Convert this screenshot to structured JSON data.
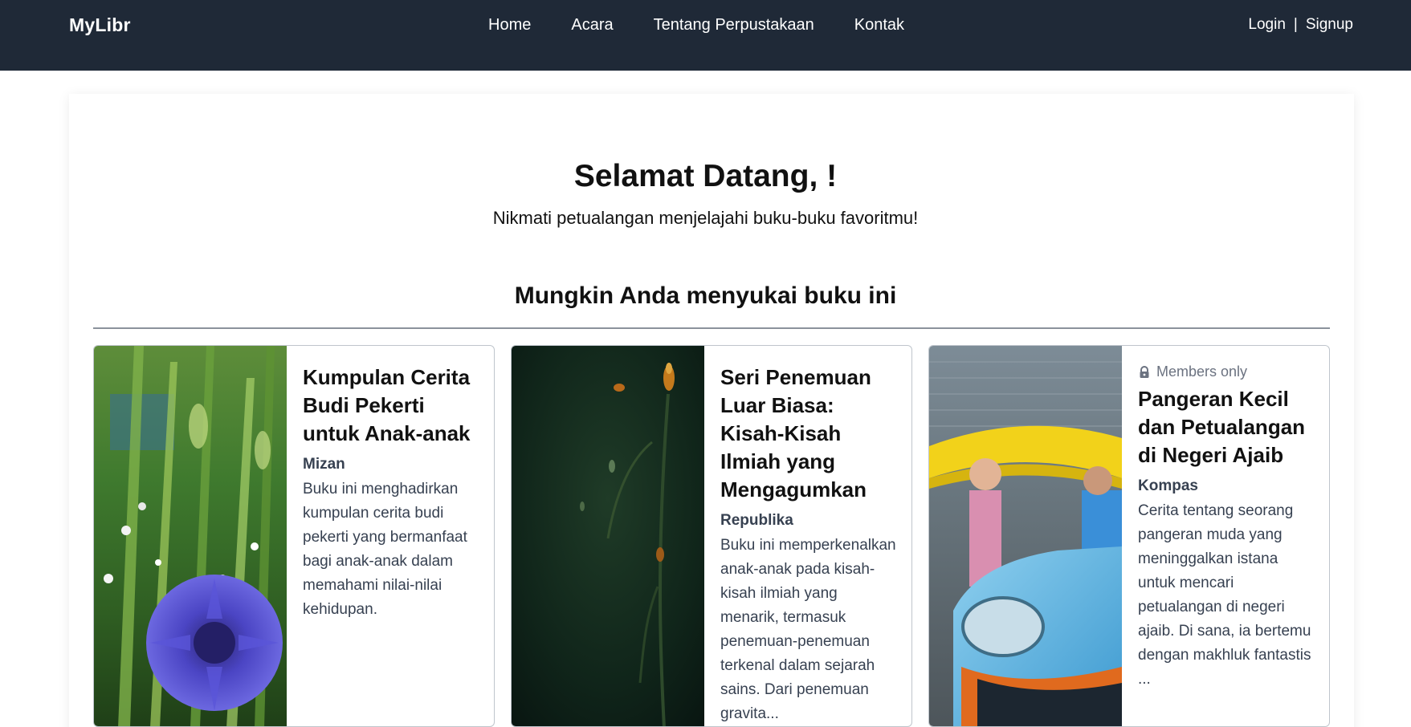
{
  "nav": {
    "brand": "MyLibr",
    "links": [
      "Home",
      "Acara",
      "Tentang Perpustakaan",
      "Kontak"
    ],
    "login": "Login",
    "separator": "|",
    "signup": "Signup"
  },
  "hero": {
    "title": "Selamat Datang, !",
    "subtitle": "Nikmati petualangan menjelajahi buku-buku favoritmu!"
  },
  "section": {
    "title": "Mungkin Anda menyukai buku ini"
  },
  "books": [
    {
      "title": "Kumpulan Cerita Budi Pekerti untuk Anak-anak",
      "publisher": "Mizan",
      "description": "Buku ini menghadirkan kumpulan cerita budi pekerti yang bermanfaat bagi anak-anak dalam memahami nilai-nilai kehidupan.",
      "badge": ""
    },
    {
      "title": "Seri Penemuan Luar Biasa: Kisah-Kisah Ilmiah yang Mengagumkan",
      "publisher": "Republika",
      "description": "Buku ini memperkenalkan anak-anak pada kisah-kisah ilmiah yang menarik, termasuk penemuan-penemuan terkenal dalam sejarah sains. Dari penemuan gravita...",
      "badge": ""
    },
    {
      "title": "Pangeran Kecil dan Petualangan di Negeri Ajaib",
      "publisher": "Kompas",
      "description": "Cerita tentang seorang pangeran muda yang meninggalkan istana untuk mencari petualangan di negeri ajaib. Di sana, ia bertemu dengan makhluk fantastis ...",
      "badge": "Members only"
    }
  ],
  "colors": {
    "navbar": "#1f2937",
    "text_muted": "#374151",
    "badge_gray": "#6b7280"
  }
}
